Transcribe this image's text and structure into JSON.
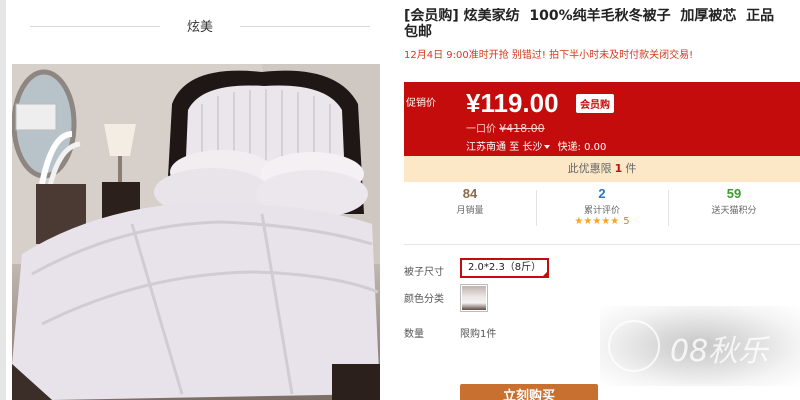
{
  "shop": {
    "brand_name": "炫美"
  },
  "product": {
    "title": "[会员购] 炫美家纺  100%纯羊毛秋冬被子  加厚被芯  正品\n包邮",
    "subtitle_time": "12月4日 9:00准时开抢",
    "subtitle_note1": "别错过!",
    "subtitle_note2": "拍下半小时未及时付款关闭交易!",
    "image_alt": "bed-with-white-wool-quilt"
  },
  "price": {
    "label": "促销价",
    "value": "¥119.00",
    "badge": "会员购",
    "original_label": "一口价",
    "original_value": "¥418.00",
    "ship_from": "江苏南通",
    "ship_to_word": "至",
    "ship_to": "长沙",
    "express": "快递: 0.00"
  },
  "promo": {
    "prefix": "此优惠限",
    "count": "1",
    "suffix": "件"
  },
  "stats": [
    {
      "value": "84",
      "label": "月销量",
      "color": "#8b6b4b"
    },
    {
      "value": "2",
      "label": "累计评价",
      "color": "#2a78c2",
      "stars": "★★★★★",
      "star_count": "5"
    },
    {
      "value": "59",
      "label": "送天猫积分",
      "color": "#3a9b2e"
    }
  ],
  "options": {
    "size_label": "被子尺寸",
    "size_value": "2.0*2.3（8斤）",
    "color_label": "颜色分类",
    "qty_label": "数量",
    "qty_limit": "限购1件"
  },
  "buy_button": "立刻购买",
  "watermark": "08秋乐",
  "colors": {
    "price_red": "#c40c0c",
    "promo_bg": "#fce8c7",
    "buy_orange": "#c8702f"
  }
}
